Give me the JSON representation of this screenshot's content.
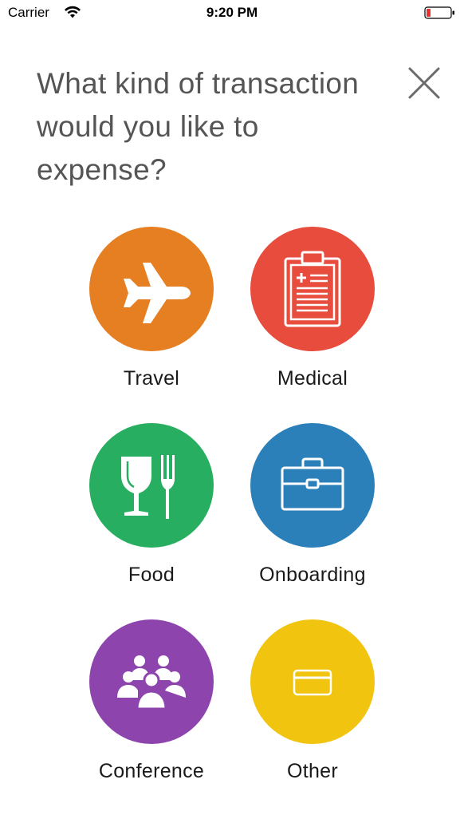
{
  "status_bar": {
    "carrier": "Carrier",
    "time": "9:20 PM",
    "wifi_icon": "wifi-icon",
    "battery_icon": "battery-low-icon",
    "battery_color": "#e8322f"
  },
  "header": {
    "title": "What kind of transaction would you like to expense?",
    "close_icon": "close-icon"
  },
  "categories": [
    {
      "label": "Travel",
      "icon": "airplane-icon",
      "color": "#e67e22"
    },
    {
      "label": "Medical",
      "icon": "clipboard-icon",
      "color": "#e74c3c"
    },
    {
      "label": "Food",
      "icon": "glass-fork-icon",
      "color": "#27ae60"
    },
    {
      "label": "Onboarding",
      "icon": "briefcase-icon",
      "color": "#2c80b9"
    },
    {
      "label": "Conference",
      "icon": "group-icon",
      "color": "#8e44ad"
    },
    {
      "label": "Other",
      "icon": "card-icon",
      "color": "#f1c40f"
    }
  ]
}
